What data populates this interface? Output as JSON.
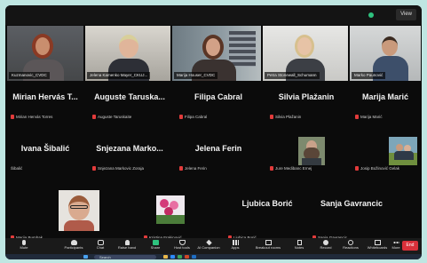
{
  "window": {
    "view_label": "View"
  },
  "video_strip": [
    {
      "name": "Kuzmanovic_CVDC"
    },
    {
      "name": "Jelena Kamenko Mayer_CKUJ..."
    },
    {
      "name": "Marija Houser_CVDC"
    },
    {
      "name": "Petra Stonewall_Schumann"
    },
    {
      "name": "Marko Paunović"
    }
  ],
  "participants": [
    {
      "big": "Mirian Hervás T...",
      "small": "Mirian Hervás Torres"
    },
    {
      "big": "Auguste  Taruska...",
      "small": "Auguste Taruskaite"
    },
    {
      "big": "Filipa Cabral",
      "small": "Filipa Cabral"
    },
    {
      "big": "Silvia Plažanin",
      "small": "Silvia Plažanin"
    },
    {
      "big": "Marija Marić",
      "small": "Marija Marić"
    },
    {
      "big": "Ivana Šibalić",
      "small": "Šibalić"
    },
    {
      "big": "Snjezana  Marko...",
      "small": "Snjezana Markovic Zoraja"
    },
    {
      "big": "Jelena Ferin",
      "small": "Jelena Ferin"
    },
    {
      "big": "",
      "small": "Jure Medibanc Ernej"
    },
    {
      "big": "",
      "small": "Josip Božinović Gelak"
    },
    {
      "big": "",
      "small": "Marija Bumbak"
    },
    {
      "big": "",
      "small": "Kristina Frakinović"
    },
    {
      "big": "Ljubica Borić",
      "small": "Ljubica Borić"
    },
    {
      "big": "Sanja Gavrancic",
      "small": "Sanja Gavrancic"
    }
  ],
  "toolbar": {
    "items": [
      "Mute",
      "Participants",
      "Chat",
      "Raise hand",
      "Share",
      "Host tools",
      "AI Companion",
      "Apps",
      "Breakout rooms",
      "Notes",
      "Record",
      "Reactions",
      "Whiteboards",
      "More"
    ],
    "end": "End"
  },
  "taskbar": {
    "search_placeholder": "Search"
  },
  "colors": {
    "active_speaker": "#3ad07a",
    "background": "#0b0b0b",
    "muted": "#e23b3b",
    "end_button": "#d9303a"
  }
}
